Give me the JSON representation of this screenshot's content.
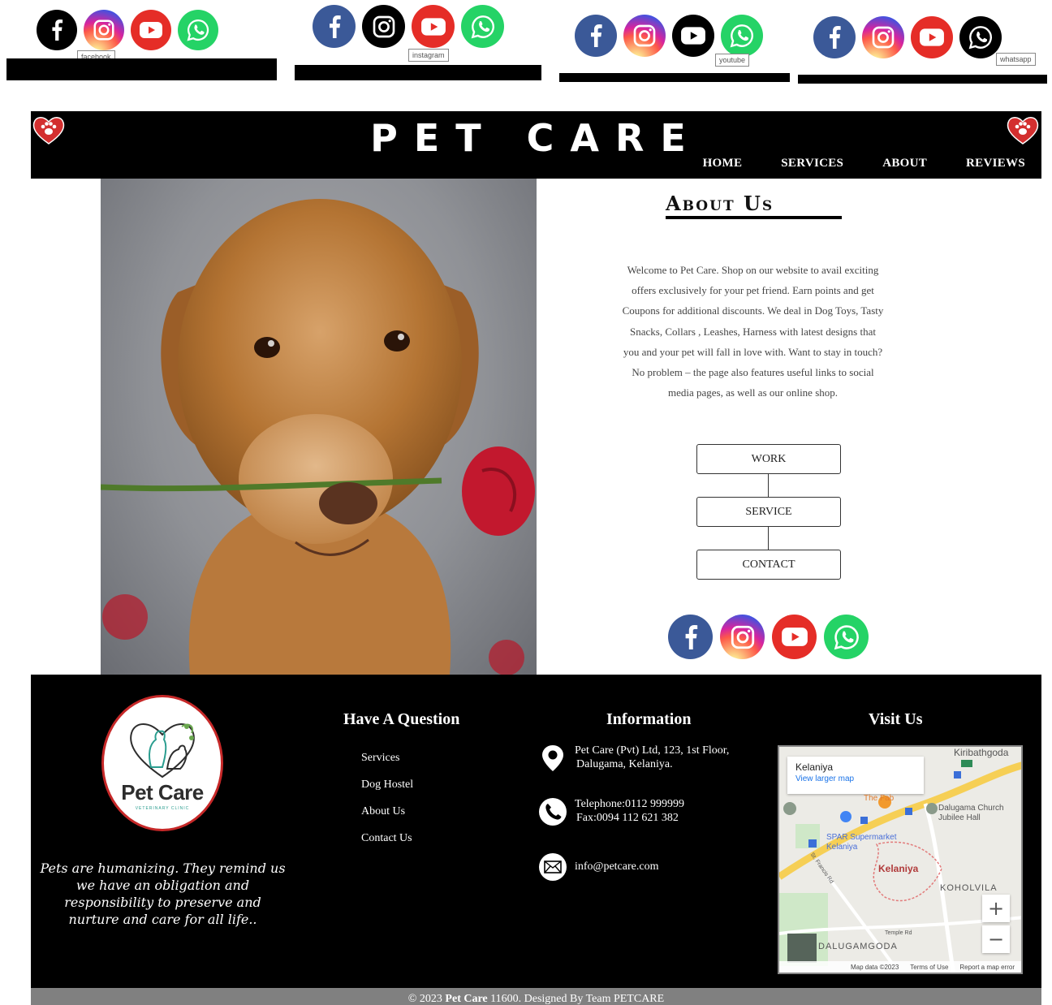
{
  "hover_demo": {
    "tooltips": [
      "facebook",
      "instagram",
      "youtube",
      "whatsapp"
    ]
  },
  "header": {
    "title": "PET CARE",
    "nav": [
      "HOME",
      "SERVICES",
      "ABOUT",
      "REVIEWS"
    ]
  },
  "about": {
    "title": "About Us",
    "paragraph": "Welcome to Pet Care. Shop on our website to avail exciting offers exclusively for your pet friend. Earn points and get Coupons for additional discounts. We deal in Dog Toys, Tasty Snacks, Collars , Leashes, Harness with latest designs that you and your pet will fall in love with. Want to stay in touch? No problem – the page also features useful links to social media pages, as well as our online shop.",
    "buttons": [
      "WORK",
      "SERVICE",
      "CONTACT"
    ]
  },
  "footer": {
    "logo_name": "Pet Care",
    "logo_sub": "VETERINARY CLINIC",
    "quote": "Pets are humanizing. They remind us we have an obligation and responsibility to preserve and nurture and care for all life..",
    "question_title": "Have A Question",
    "question_links": [
      "Services",
      "Dog Hostel",
      "About Us",
      "Contact Us"
    ],
    "info_title": "Information",
    "address_line1": "Pet Care (Pvt) Ltd, 123, 1st Floor,",
    "address_line2": "Dalugama, Kelaniya.",
    "telephone": "Telephone:0112 999999",
    "fax": "Fax:0094 112 621 382",
    "email": "info@petcare.com",
    "visit_title": "Visit Us",
    "map": {
      "place": "Kelaniya",
      "larger_map": "View larger map",
      "labels": [
        "Kiribathgoda",
        "The Fab",
        "Dalugama Church Jubilee Hall",
        "SPAR Supermarket Kelaniya",
        "Kelaniya",
        "KOHOLVILA",
        "DALUGAMGODA",
        "Temple Rd",
        "St. Francis Rd"
      ],
      "attribution": [
        "Map data ©2023",
        "Terms of Use",
        "Report a map error"
      ]
    }
  },
  "copyright": {
    "prefix": "© 2023 ",
    "brand": "Pet Care",
    "suffix": " 11600. Designed By Team PETCARE"
  },
  "colors": {
    "facebook": "#3b5998",
    "youtube": "#e52d27",
    "whatsapp": "#25d366",
    "heart": "#d32f2f",
    "footer_bar": "#808080"
  }
}
